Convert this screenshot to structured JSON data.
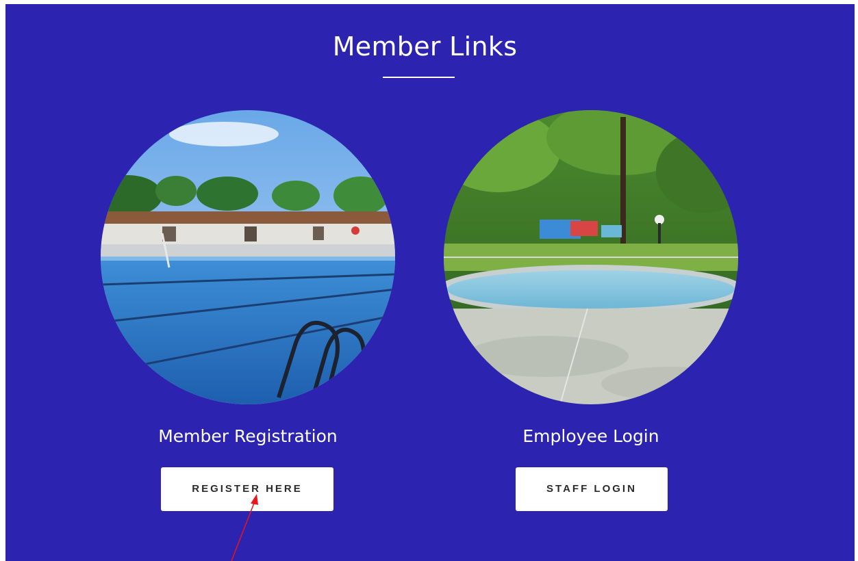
{
  "section": {
    "title": "Member Links",
    "background_color": "#2c24b0"
  },
  "cards": [
    {
      "image_alt": "outdoor swimming pool photo",
      "title": "Member Registration",
      "button_label": "REGISTER HERE"
    },
    {
      "image_alt": "park playground with wading pool photo",
      "title": "Employee Login",
      "button_label": "STAFF LOGIN"
    }
  ],
  "annotation": {
    "arrow_color": "#e8141c"
  }
}
